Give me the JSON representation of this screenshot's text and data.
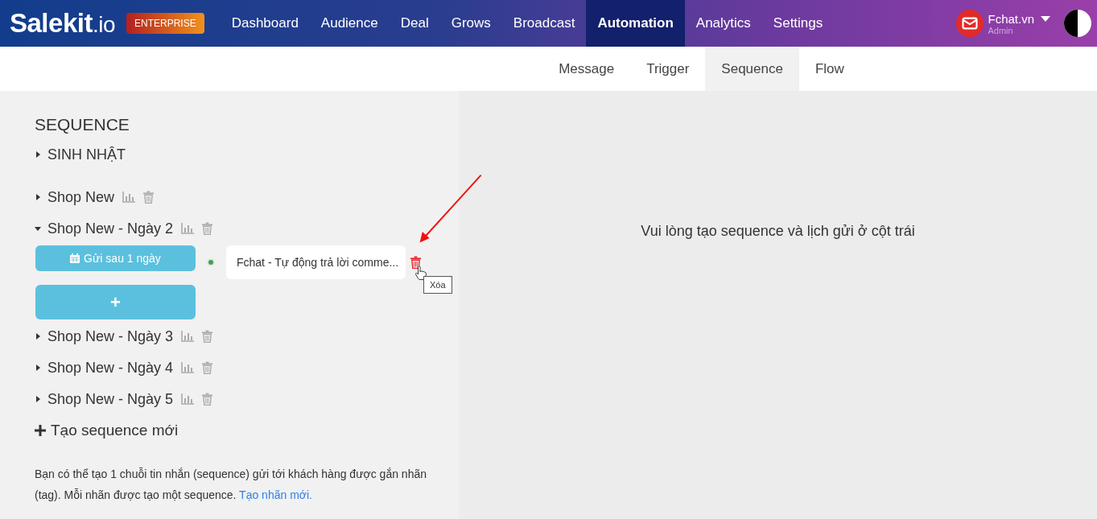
{
  "brand": {
    "logo": "Salekit",
    "logo_suffix": ".io",
    "badge": "ENTERPRISE"
  },
  "nav": [
    {
      "label": "Dashboard",
      "selected": false
    },
    {
      "label": "Audience",
      "selected": false
    },
    {
      "label": "Deal",
      "selected": false
    },
    {
      "label": "Grows",
      "selected": false
    },
    {
      "label": "Broadcast",
      "selected": false
    },
    {
      "label": "Automation",
      "selected": true
    },
    {
      "label": "Analytics",
      "selected": false
    },
    {
      "label": "Settings",
      "selected": false
    }
  ],
  "account": {
    "name": "Fchat.vn",
    "role": "Admin"
  },
  "subnav": [
    {
      "label": "Message",
      "selected": false
    },
    {
      "label": "Trigger",
      "selected": false
    },
    {
      "label": "Sequence",
      "selected": true
    },
    {
      "label": "Flow",
      "selected": false
    }
  ],
  "heading": "SEQUENCE",
  "sequences": [
    {
      "name": "SINH NHẬT",
      "kind": "plain",
      "expanded": false
    },
    {
      "name": "Shop New",
      "kind": "tagged",
      "expanded": false
    },
    {
      "name": "Shop New - Ngày 2",
      "kind": "tagged",
      "expanded": true,
      "schedule": "Gửi sau 1 ngày",
      "message": "Fchat - Tự động trả lời comme...",
      "tooltip": "Xóa"
    },
    {
      "name": "Shop New - Ngày 3",
      "kind": "tagged",
      "expanded": false
    },
    {
      "name": "Shop New - Ngày 4",
      "kind": "tagged",
      "expanded": false
    },
    {
      "name": "Shop New - Ngày 5",
      "kind": "tagged",
      "expanded": false
    }
  ],
  "add_plus": "+",
  "new_sequence": "Tạo sequence mới",
  "help": "Bạn có thể tạo 1 chuỗi tin nhắn (sequence) gửi tới khách hàng được gắn nhãn (tag). Mỗi nhãn được tạo một sequence.",
  "help_link": "Tạo nhãn mới.",
  "empty_message": "Vui lòng tạo sequence và lịch gửi ở cột trái"
}
